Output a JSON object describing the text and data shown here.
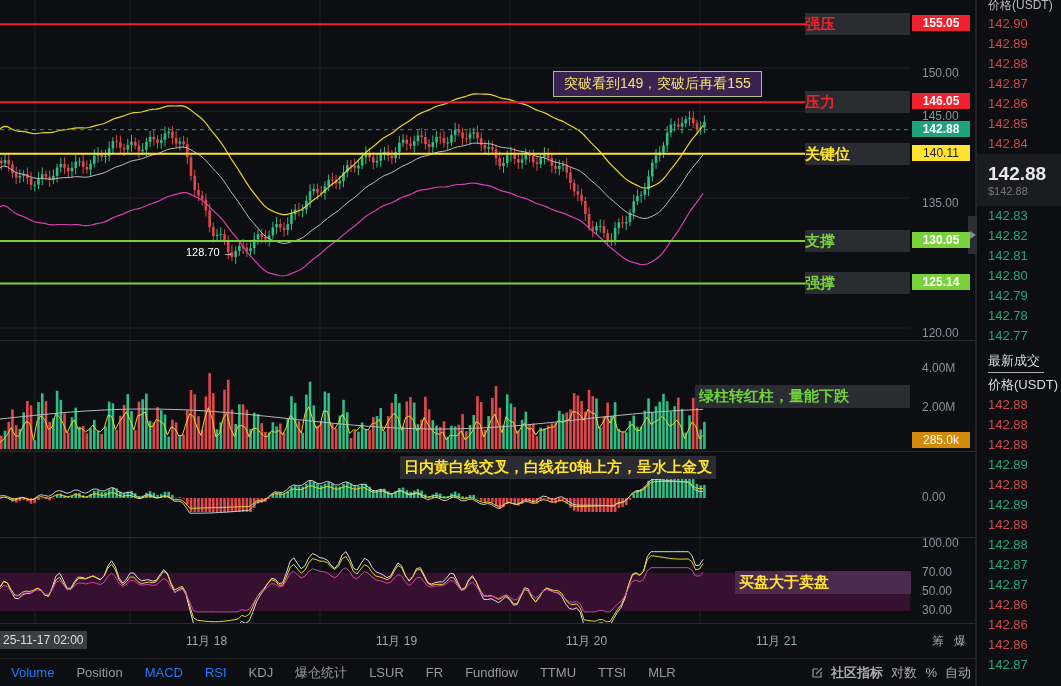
{
  "price_levels": [
    {
      "label": "强压",
      "price": "155.05",
      "color": "#f0202c",
      "dashed": false
    },
    {
      "label": "压力",
      "price": "146.05",
      "color": "#f0202c",
      "dashed": false
    },
    {
      "price": "142.88",
      "color": "#1fa37f",
      "dashed": true
    },
    {
      "label": "关键位",
      "price": "140.11",
      "color": "#ffe32e",
      "dashed": false
    },
    {
      "label": "支撑",
      "price": "130.05",
      "color": "#79d13c",
      "dashed": false
    },
    {
      "label": "强撑",
      "price": "125.14",
      "color": "#79d13c",
      "dashed": false
    }
  ],
  "price_axis": [
    "150.00",
    "145.00",
    "135.00",
    "120.00"
  ],
  "callout": "突破看到149，突破后再看155",
  "low_marker": "128.70 →",
  "volume": {
    "note": "绿柱转红柱，量能下跌",
    "axis": [
      "4.00M",
      "2.00M"
    ],
    "current": "285.0k"
  },
  "macd": {
    "note": "日内黄白线交叉，白线在0轴上方，呈水上金叉",
    "axis": [
      "0.00"
    ]
  },
  "rsi": {
    "note": "买盘大于卖盘",
    "axis": [
      "100.00",
      "70.00",
      "50.00",
      "30.00"
    ]
  },
  "time_axis": {
    "cursor": "25-11-17 02:00",
    "labels": [
      "11月 18",
      "11月 19",
      "11月 20",
      "11月 21"
    ],
    "corner": [
      "筹",
      "爆"
    ]
  },
  "indicator_tabs": [
    {
      "label": "Volume",
      "selected": true
    },
    {
      "label": "Position",
      "selected": false
    },
    {
      "label": "MACD",
      "selected": true
    },
    {
      "label": "RSI",
      "selected": true
    },
    {
      "label": "KDJ",
      "selected": false
    },
    {
      "label": "爆仓统计",
      "selected": false
    },
    {
      "label": "LSUR",
      "selected": false
    },
    {
      "label": "FR",
      "selected": false
    },
    {
      "label": "Fundflow",
      "selected": false
    },
    {
      "label": "TTMU",
      "selected": false
    },
    {
      "label": "TTSI",
      "selected": false
    },
    {
      "label": "MLR",
      "selected": false
    }
  ],
  "tools": [
    {
      "label": "社区指标",
      "kind": "community"
    },
    {
      "label": "对数",
      "kind": "text"
    },
    {
      "label": "%",
      "kind": "text"
    },
    {
      "label": "自动",
      "kind": "text"
    }
  ],
  "order_book": {
    "header": "价格(USDT)",
    "asks": [
      "142.90",
      "142.89",
      "142.88",
      "142.87",
      "142.86",
      "142.85",
      "142.84"
    ],
    "last": "142.88",
    "last_usd": "$142.88",
    "bids": [
      "142.83",
      "142.82",
      "142.81",
      "142.80",
      "142.79",
      "142.78",
      "142.77"
    ],
    "trades_title": "最新成交",
    "trades_header": "价格(USDT)",
    "trades": [
      {
        "price": "142.88",
        "color": "#d2484e"
      },
      {
        "price": "142.88",
        "color": "#d2484e"
      },
      {
        "price": "142.88",
        "color": "#d2484e"
      },
      {
        "price": "142.89",
        "color": "#24a57d"
      },
      {
        "price": "142.88",
        "color": "#d2484e"
      },
      {
        "price": "142.89",
        "color": "#24a57d"
      },
      {
        "price": "142.88",
        "color": "#d2484e"
      },
      {
        "price": "142.88",
        "color": "#24a57d"
      },
      {
        "price": "142.87",
        "color": "#24a57d"
      },
      {
        "price": "142.87",
        "color": "#24a57d"
      },
      {
        "price": "142.86",
        "color": "#d2484e"
      },
      {
        "price": "142.86",
        "color": "#d2484e"
      },
      {
        "price": "142.86",
        "color": "#d2484e"
      },
      {
        "price": "142.87",
        "color": "#24a57d"
      }
    ]
  }
}
